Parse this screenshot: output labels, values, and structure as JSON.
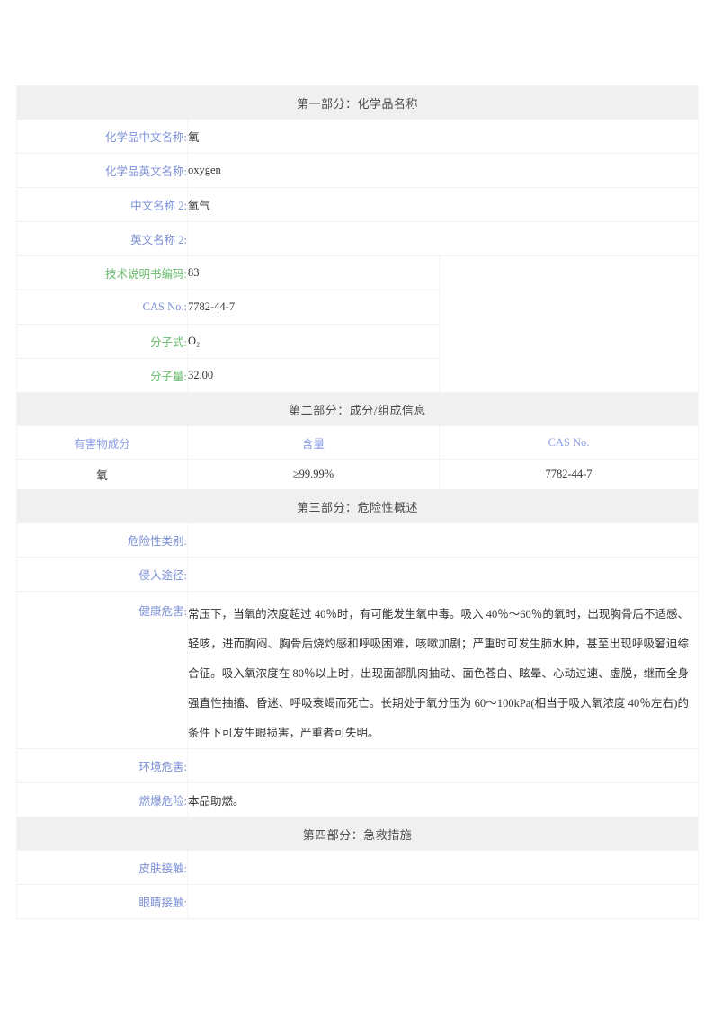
{
  "document": {
    "type": "msds-safety-data-sheet",
    "language": "zh-CN"
  },
  "sections": {
    "s1_title": "第一部分：化学品名称",
    "s2_title": "第二部分：成分/组成信息",
    "s3_title": "第三部分：危险性概述",
    "s4_title": "第四部分：急救措施"
  },
  "section1": {
    "rows": [
      {
        "label": "化学品中文名称:",
        "value": "氧"
      },
      {
        "label": "化学品英文名称:",
        "value": "oxygen"
      },
      {
        "label": "中文名称 2:",
        "value": "氧气"
      },
      {
        "label": "英文名称 2:",
        "value": ""
      },
      {
        "label": "技术说明书编码:",
        "value": "83"
      },
      {
        "label": "CAS No.:",
        "value": "7782-44-7"
      },
      {
        "label": "分子式:",
        "value": "O₂"
      },
      {
        "label": "分子量:",
        "value": "32.00"
      }
    ]
  },
  "section2": {
    "headers": [
      "有害物成分",
      "含量",
      "CAS No."
    ],
    "rows": [
      [
        "氧",
        "≥99.99%",
        "7782-44-7"
      ]
    ]
  },
  "section3": {
    "rows": [
      {
        "label": "危险性类别:",
        "value": ""
      },
      {
        "label": "侵入途径:",
        "value": ""
      },
      {
        "label": "健康危害:",
        "value": "常压下，当氧的浓度超过 40％时，有可能发生氧中毒。吸入 40％～60％的氧时，出现胸骨后不适感、轻咳，进而胸闷、胸骨后烧灼感和呼吸困难，咳嗽加剧；严重时可发生肺水肿，甚至出现呼吸窘迫综合征。吸入氧浓度在 80％以上时，出现面部肌肉抽动、面色苍白、眩晕、心动过速、虚脱，继而全身强直性抽搐、昏迷、呼吸衰竭而死亡。长期处于氧分压为 60～100kPa(相当于吸入氧浓度 40％左右)的条件下可发生眼损害，严重者可失明。"
      },
      {
        "label": "环境危害:",
        "value": ""
      },
      {
        "label": "燃爆危险:",
        "value": "本品助燃。"
      }
    ]
  },
  "section4": {
    "rows": [
      {
        "label": "皮肤接触:",
        "value": ""
      },
      {
        "label": "眼睛接触:",
        "value": ""
      }
    ]
  },
  "colors": {
    "label_blue": "#8c9ee8",
    "label_green": "#68bb6c",
    "section_bg": "#f0f0f0",
    "text": "#333333",
    "border": "#f2f2f2"
  }
}
